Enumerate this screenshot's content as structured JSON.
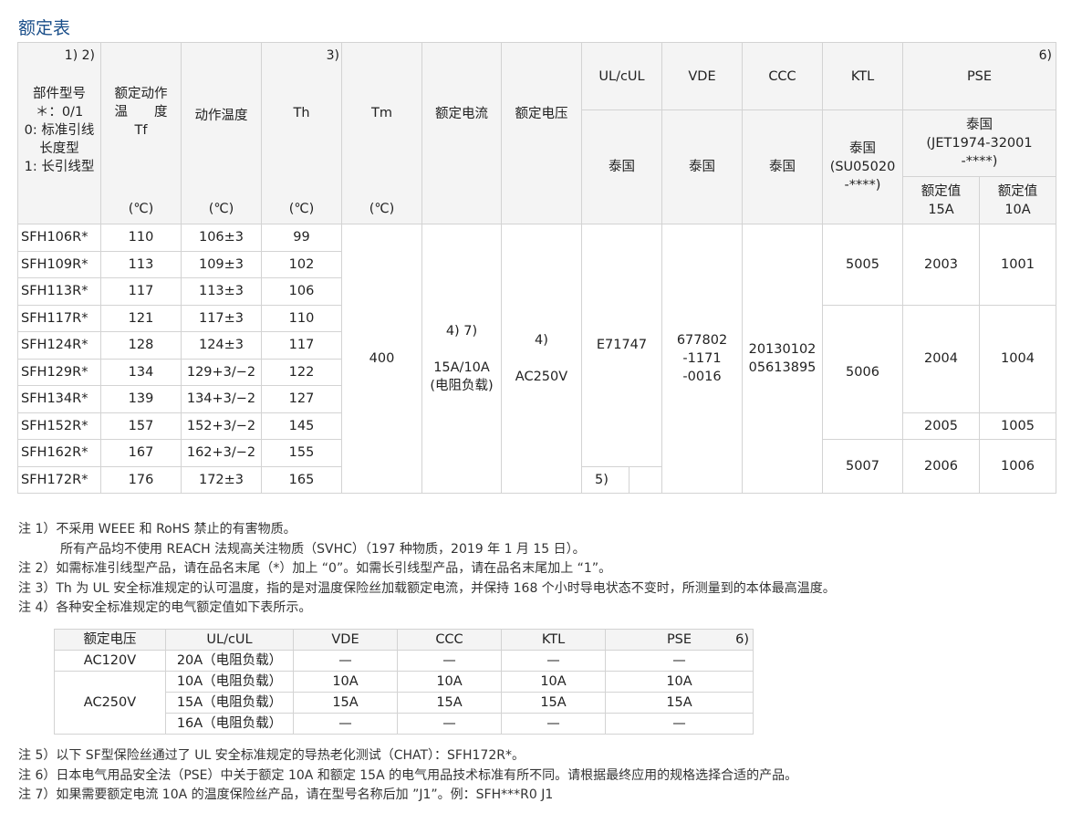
{
  "title": "额定表",
  "header": {
    "part_note": "1) 2)",
    "part_lines": [
      "部件型号",
      "＊：0/1",
      "0: 标准引线",
      "长度型",
      "1: 长引线型"
    ],
    "tf_lines": [
      "额定动作",
      "温　　度",
      "Tf"
    ],
    "tf_unit": "(℃)",
    "op_temp": "动作温度",
    "op_unit": "(℃)",
    "th": "Th",
    "th_note": "3)",
    "th_unit": "(℃)",
    "tm": "Tm",
    "tm_unit": "(℃)",
    "current": "额定电流",
    "voltage": "额定电压",
    "ul": "UL/cUL",
    "vde": "VDE",
    "ccc": "CCC",
    "ktl": "KTL",
    "pse": "PSE",
    "pse_note": "6)",
    "ul_country": "泰国",
    "vde_country": "泰国",
    "ccc_country": "泰国",
    "ktl_country_lines": [
      "泰国",
      "(SU05020",
      "-****)"
    ],
    "pse_country_lines": [
      "泰国",
      "(JET1974-32001",
      "-****)"
    ],
    "pse_15a_lines": [
      "额定值",
      "15A"
    ],
    "pse_10a_lines": [
      "额定值",
      "10A"
    ]
  },
  "rows": [
    {
      "part": "SFH106R*",
      "tf": "110",
      "op": "106±3",
      "th": "99"
    },
    {
      "part": "SFH109R*",
      "tf": "113",
      "op": "109±3",
      "th": "102"
    },
    {
      "part": "SFH113R*",
      "tf": "117",
      "op": "113±3",
      "th": "106"
    },
    {
      "part": "SFH117R*",
      "tf": "121",
      "op": "117±3",
      "th": "110"
    },
    {
      "part": "SFH124R*",
      "tf": "128",
      "op": "124±3",
      "th": "117"
    },
    {
      "part": "SFH129R*",
      "tf": "134",
      "op": "129+3/−2",
      "th": "122"
    },
    {
      "part": "SFH134R*",
      "tf": "139",
      "op": "134+3/−2",
      "th": "127"
    },
    {
      "part": "SFH152R*",
      "tf": "157",
      "op": "152+3/−2",
      "th": "145"
    },
    {
      "part": "SFH162R*",
      "tf": "167",
      "op": "162+3/−2",
      "th": "155"
    },
    {
      "part": "SFH172R*",
      "tf": "176",
      "op": "172±3",
      "th": "165"
    }
  ],
  "merged": {
    "tm": "400",
    "current_lines": [
      "4) 7)",
      "",
      "15A/10A",
      "(电阻负载)"
    ],
    "voltage_lines": [
      "4)",
      "",
      "AC250V"
    ],
    "ul": "E71747",
    "ul_note": "5)",
    "vde_lines": [
      "677802",
      "-1171",
      "-0016"
    ],
    "ccc_lines": [
      "20130102",
      "05613895"
    ],
    "ktl": [
      "5005",
      "5006",
      "5007"
    ],
    "pse15": [
      "2003",
      "2004",
      "2005",
      "2006"
    ],
    "pse10": [
      "1001",
      "1004",
      "1005",
      "1006"
    ]
  },
  "notes_top": [
    "注 1）不采用 WEEE 和 RoHS 禁止的有害物质。",
    "所有产品均不使用 REACH 法规高关注物质（SVHC）（197 种物质，2019 年 1 月 15 日）。",
    "注 2）如需标准引线型产品，请在品名末尾（*）加上 “0”。如需长引线型产品，请在品名末尾加上 “1”。",
    "注 3）Th 为 UL 安全标准规定的认可温度，指的是对温度保险丝加载额定电流，并保持 168 个小时导电状态不变时，所测量到的本体最高温度。",
    "注 4）各种安全标准规定的电气额定值如下表所示。"
  ],
  "subtable": {
    "headers": [
      "额定电压",
      "UL/cUL",
      "VDE",
      "CCC",
      "KTL",
      "PSE"
    ],
    "pse_note": "6)",
    "rows": [
      {
        "voltage": "AC120V",
        "ul": "20A（电阻负载）",
        "vde": "—",
        "ccc": "—",
        "ktl": "—",
        "pse": "—"
      },
      {
        "voltage": "AC250V",
        "ul": "10A（电阻负载）",
        "vde": "10A",
        "ccc": "10A",
        "ktl": "10A",
        "pse": "10A"
      },
      {
        "voltage": "",
        "ul": "15A（电阻负载）",
        "vde": "15A",
        "ccc": "15A",
        "ktl": "15A",
        "pse": "15A"
      },
      {
        "voltage": "",
        "ul": "16A（电阻负载）",
        "vde": "—",
        "ccc": "—",
        "ktl": "—",
        "pse": "—"
      }
    ]
  },
  "notes_bottom": [
    "注 5）以下 SF型保险丝通过了 UL 安全标准规定的导热老化测试（CHAT）：SFH172R*。",
    "注 6）日本电气用品安全法（PSE）中关于额定 10A 和额定 15A 的电气用品技术标准有所不同。请根据最终应用的规格选择合适的产品。",
    "注 7）如果需要额定电流 10A 的温度保险丝产品，请在型号名称后加 ”J1”。例：SFH***R0 J1"
  ]
}
